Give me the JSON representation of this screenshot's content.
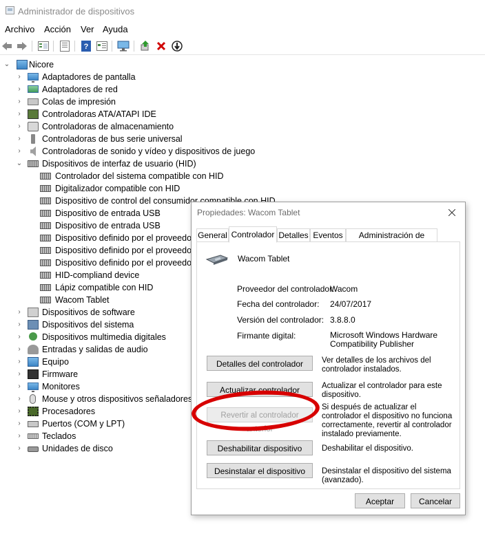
{
  "window": {
    "title": "Administrador de dispositivos",
    "menu": [
      "Archivo",
      "Acción",
      "Ver",
      "Ayuda"
    ],
    "toolbar_icons": [
      "back-icon",
      "forward-icon",
      "tree-view-icon",
      "properties-icon",
      "help-icon",
      "details-icon",
      "monitor-icon",
      "update-driver-icon",
      "uninstall-icon",
      "scan-icon"
    ]
  },
  "tree": {
    "root": "Nicore",
    "categories": [
      "Adaptadores de pantalla",
      "Adaptadores de red",
      "Colas de impresión",
      "Controladoras ATA/ATAPI IDE",
      "Controladoras de almacenamiento",
      "Controladoras de bus serie universal",
      "Controladoras de sonido y vídeo y dispositivos de juego",
      "Dispositivos de interfaz de usuario (HID)"
    ],
    "hid_children": [
      "Controlador del sistema compatible con HID",
      "Digitalizador compatible con HID",
      "Dispositivo de control del consumidor compatible con HID",
      "Dispositivo de entrada USB",
      "Dispositivo de entrada USB",
      "Dispositivo definido por el proveedor",
      "Dispositivo definido por el proveedor",
      "Dispositivo definido por el proveedor",
      "HID-compliand device",
      "Lápiz compatible con HID",
      "Wacom Tablet"
    ],
    "categories_after": [
      "Dispositivos de software",
      "Dispositivos del sistema",
      "Dispositivos multimedia digitales",
      "Entradas y salidas de audio",
      "Equipo",
      "Firmware",
      "Monitores",
      "Mouse y otros dispositivos señaladores",
      "Procesadores",
      "Puertos (COM y LPT)",
      "Teclados",
      "Unidades de disco"
    ]
  },
  "dialog": {
    "title": "Propiedades: Wacom Tablet",
    "tabs": [
      "General",
      "Controlador",
      "Detalles",
      "Eventos",
      "Administración de energía"
    ],
    "active_tab": "Controlador",
    "device_name": "Wacom Tablet",
    "info": {
      "provider_label": "Proveedor del controlador:",
      "provider_value": "Wacom",
      "date_label": "Fecha del controlador:",
      "date_value": "24/07/2017",
      "version_label": "Versión del controlador:",
      "version_value": "3.8.8.0",
      "signer_label": "Firmante digital:",
      "signer_value": "Microsoft Windows Hardware Compatibility Publisher"
    },
    "actions": [
      {
        "label": "Detalles del controlador",
        "desc": "Ver detalles de los archivos del controlador instalados."
      },
      {
        "label": "Actualizar controlador",
        "desc": "Actualizar el controlador para este dispositivo."
      },
      {
        "label": "Revertir al controlador anterior",
        "desc": "Si después de actualizar el controlador el dispositivo no funciona correctamente, revertir al controlador instalado previamente."
      },
      {
        "label": "Deshabilitar dispositivo",
        "desc": "Deshabilitar el dispositivo."
      },
      {
        "label": "Desinstalar el dispositivo",
        "desc": "Desinstalar el dispositivo del sistema (avanzado)."
      }
    ],
    "ok_label": "Aceptar",
    "cancel_label": "Cancelar"
  },
  "colors": {
    "annotation": "#d70000",
    "disabled_text": "#a0a0a0"
  }
}
